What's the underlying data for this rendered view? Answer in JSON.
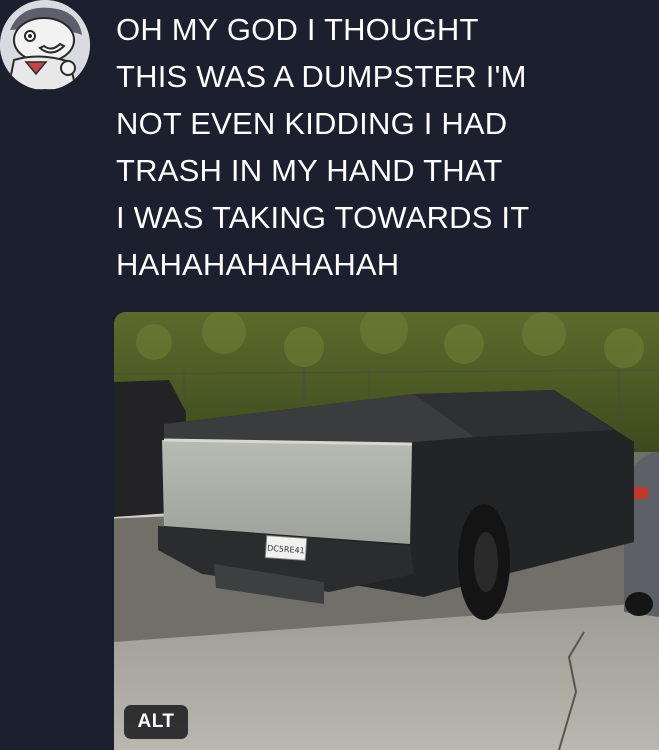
{
  "post": {
    "text_lines": [
      "OH MY GOD I THOUGHT",
      "THIS WAS A DUMPSTER I'M",
      "NOT EVEN KIDDING I HAD",
      "TRASH IN MY HAND THAT",
      "I WAS TAKING TOWARDS IT",
      "HAHAHAHAHAHAH"
    ],
    "media": {
      "alt_label": "ALT",
      "plate_text": "DC5RE41"
    }
  },
  "icons": {
    "avatar": "cartoon-avatar-icon"
  },
  "colors": {
    "background": "#1b1f2e",
    "text": "#ffffff",
    "alt_badge": "#141418"
  }
}
